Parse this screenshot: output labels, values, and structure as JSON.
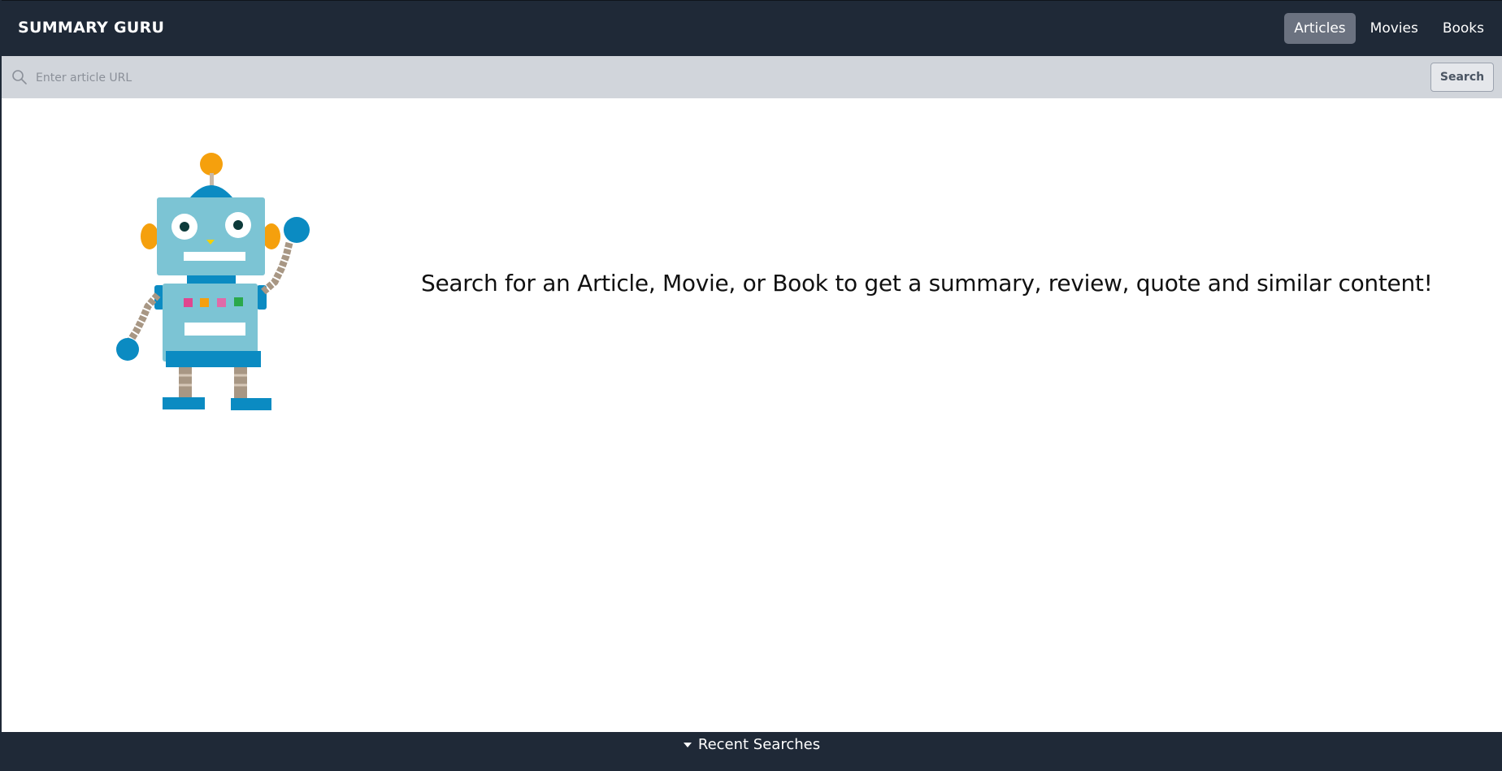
{
  "header": {
    "brand": "SUMMARY GURU",
    "tabs": [
      {
        "label": "Articles",
        "active": true
      },
      {
        "label": "Movies",
        "active": false
      },
      {
        "label": "Books",
        "active": false
      }
    ]
  },
  "search": {
    "placeholder": "Enter article URL",
    "value": "",
    "button_label": "Search",
    "icon": "search-icon"
  },
  "main": {
    "illustration": "robot-illustration",
    "message": "Search for an Article, Movie, or Book to get a summary, review, quote and similar content!"
  },
  "footer": {
    "toggle_label": "Recent Searches",
    "toggle_icon": "caret-down-icon"
  },
  "colors": {
    "navbar_bg": "#1f2937",
    "active_tab_bg": "#6b7280",
    "searchbar_bg": "#d1d5db",
    "robot_body": "#7cc4d4",
    "robot_accent": "#0b8bc2",
    "robot_orange": "#f5a00d"
  }
}
